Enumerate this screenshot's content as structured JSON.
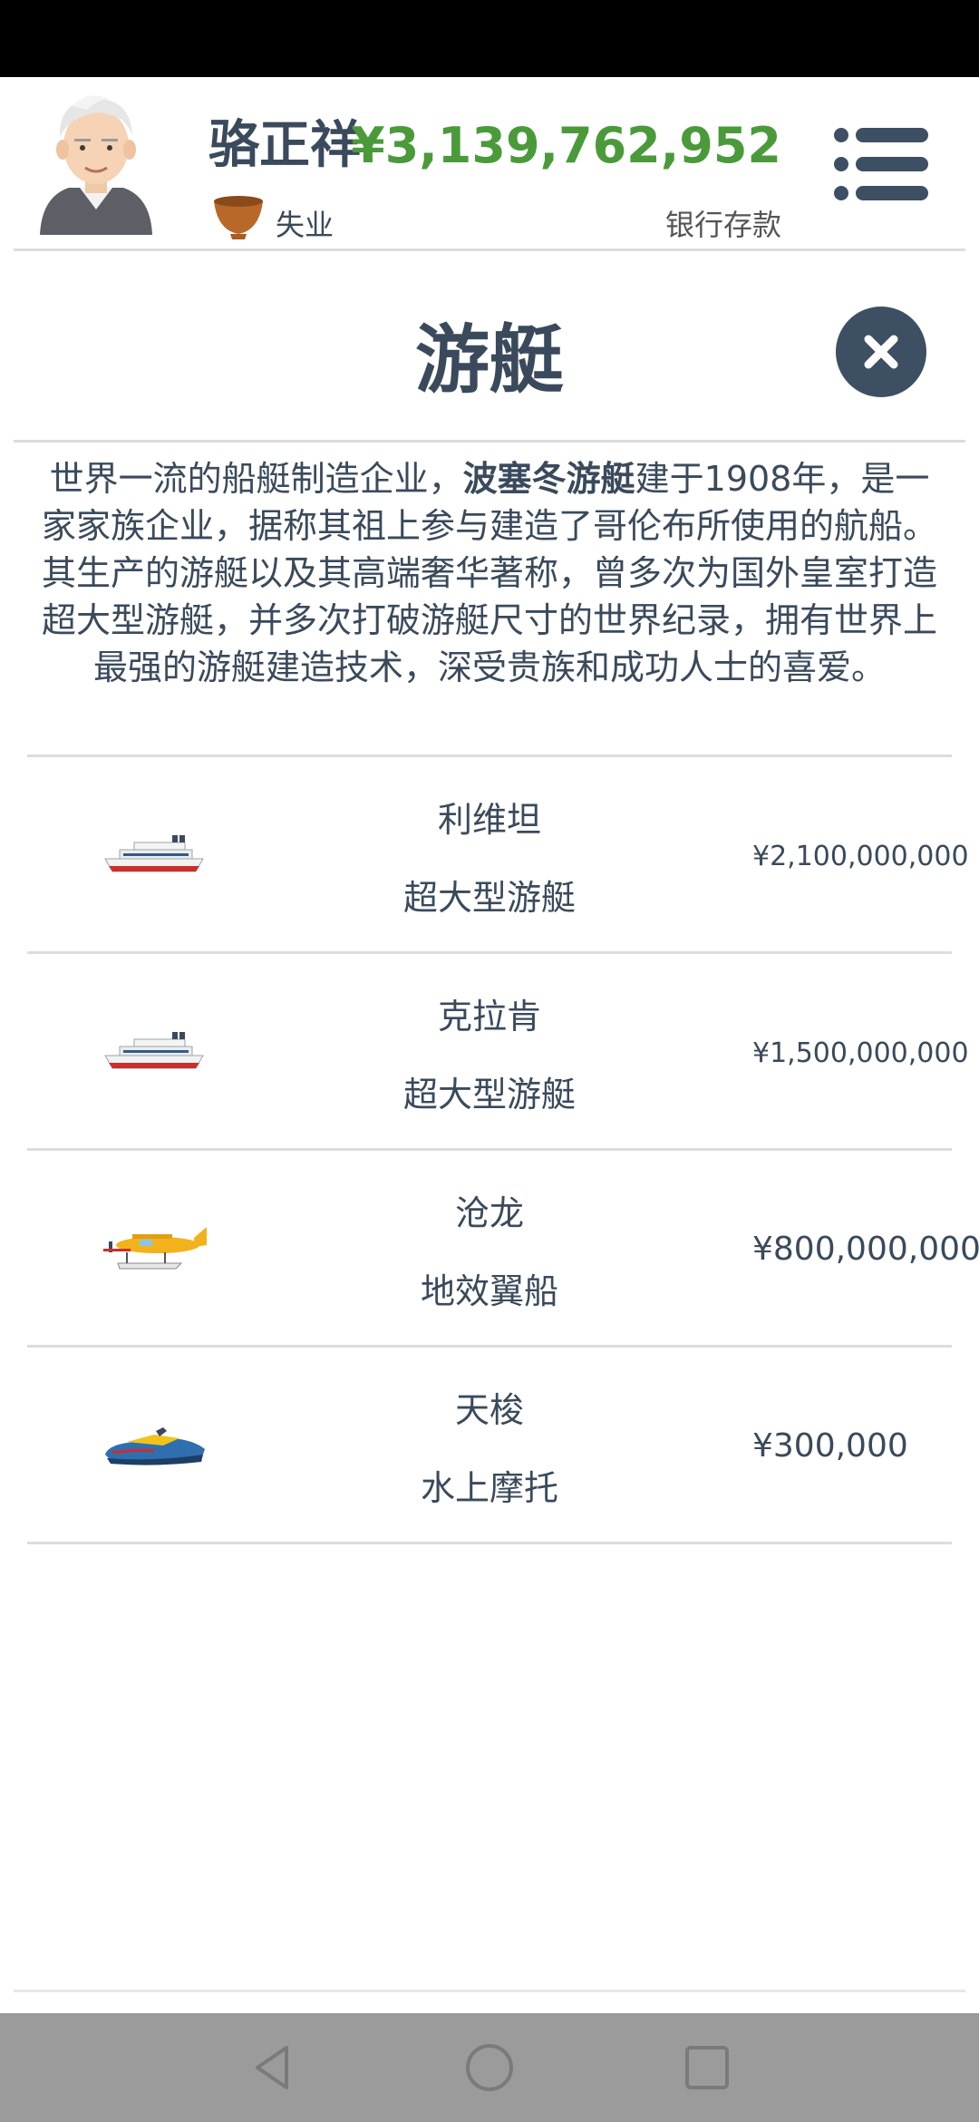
{
  "header": {
    "player_name": "骆正祥",
    "job": "失业",
    "money": "¥3,139,762,952",
    "money_label": "银行存款",
    "avatar_icon": "old-man-avatar",
    "job_icon": "bowl-icon",
    "menu_icon": "menu-list-icon",
    "money_color": "#4a9a3a"
  },
  "page": {
    "title": "游艇",
    "close_icon": "close-x-icon"
  },
  "description": {
    "before": "世界一流的船艇制造企业，",
    "brand": "波塞冬游艇",
    "after": "建于1908年，是一家家族企业，据称其祖上参与建造了哥伦布所使用的航船。其生产的游艇以及其高端奢华著称，曾多次为国外皇室打造超大型游艇，并多次打破游艇尺寸的世界纪录，拥有世界上最强的游艇建造技术，深受贵族和成功人士的喜爱。"
  },
  "items": [
    {
      "name": "利维坦",
      "type": "超大型游艇",
      "price": "¥2,100,000,000",
      "icon": "cruise-ship-icon"
    },
    {
      "name": "克拉肯",
      "type": "超大型游艇",
      "price": "¥1,500,000,000",
      "icon": "cruise-ship-icon"
    },
    {
      "name": "沧龙",
      "type": "地效翼船",
      "price": "¥800,000,000",
      "icon": "seaplane-icon"
    },
    {
      "name": "天梭",
      "type": "水上摩托",
      "price": "¥300,000",
      "icon": "jet-ski-icon"
    }
  ],
  "navbar": {
    "back_icon": "back-triangle-icon",
    "home_icon": "home-circle-icon",
    "recents_icon": "recents-square-icon"
  }
}
